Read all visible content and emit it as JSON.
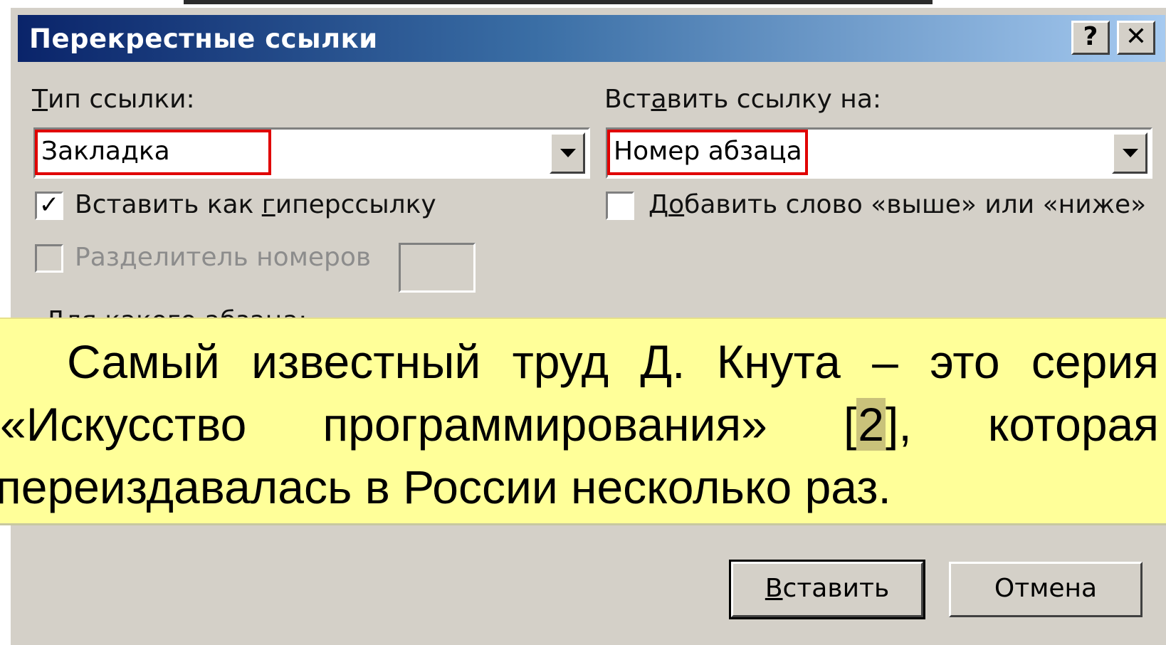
{
  "dialog": {
    "title": "Перекрестные ссылки",
    "help_glyph": "?",
    "close_glyph": "✕"
  },
  "reference_type": {
    "label_first": "Т",
    "label_rest": "ип ссылки:",
    "value": "Закладка"
  },
  "insert_ref_to": {
    "label_before": "Вст",
    "label_hot": "а",
    "label_after": "вить ссылку на:",
    "value": "Номер абзаца"
  },
  "checkboxes": {
    "hyperlink": {
      "checked": true,
      "mark": "✓",
      "label_before": "Вставить как ",
      "label_hot": "г",
      "label_after": "иперссылку"
    },
    "above_below": {
      "checked": false,
      "label_before": "Д",
      "label_hot": "о",
      "label_after": "бавить слово «выше» или «ниже»"
    },
    "separator": {
      "enabled": false,
      "label": "Разделитель номеров"
    }
  },
  "which_paragraph_label": "Для какого абзаца:",
  "overlay_text": {
    "line1_words": [
      "Самый",
      "известный",
      "труд",
      "Д.",
      "Кнута",
      "–",
      "это",
      "серия"
    ],
    "line2_a": "«Искусство",
    "line2_b": "программирования»",
    "line2_c_open": "[",
    "line2_c_field": "2",
    "line2_c_close": "],",
    "line2_d": "которая",
    "line3": "переиздавалась в России несколько раз."
  },
  "buttons": {
    "insert_hot": "В",
    "insert_rest": "ставить",
    "cancel": "Отмена"
  }
}
